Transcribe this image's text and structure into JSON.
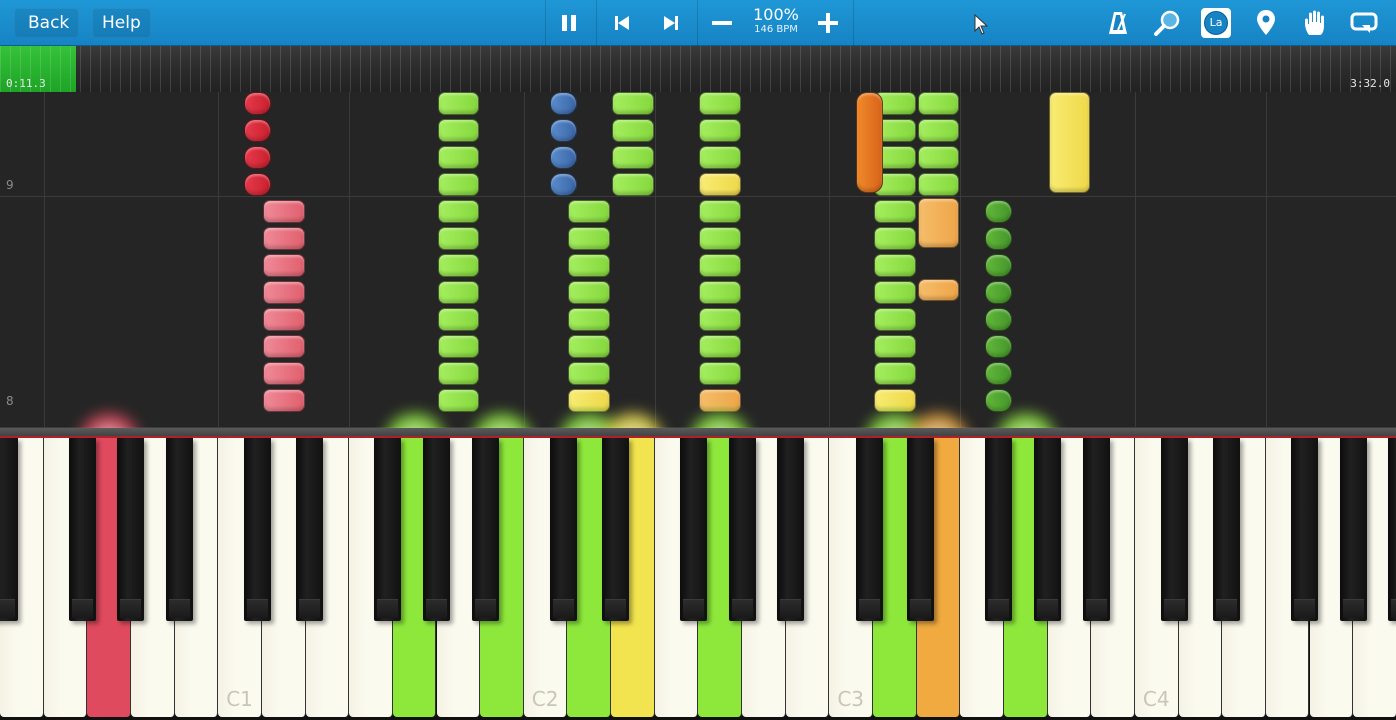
{
  "toolbar": {
    "back_label": "Back",
    "help_label": "Help",
    "tempo_percent": "100%",
    "tempo_bpm": "146 BPM",
    "icons": [
      "pause-icon",
      "skip-back-icon",
      "skip-forward-icon",
      "minus-icon",
      "plus-icon",
      "metronome-icon",
      "magnifier-icon",
      "note-label-icon",
      "location-pin-icon",
      "hand-icon",
      "loop-icon"
    ],
    "note_label_badge": "La",
    "accent_color": "#1a8dcc"
  },
  "timeline": {
    "current_time": "0:11.3",
    "total_time": "3:32.0",
    "progress_fraction": 0.053
  },
  "notes_area": {
    "measures": [
      "9",
      "8"
    ]
  },
  "keyboard": {
    "octave_labels": [
      "C1",
      "C2",
      "C3",
      "C4"
    ],
    "pressed_keys": [
      {
        "key": "G0",
        "color": "#e04a5e"
      },
      {
        "key": "G1",
        "color": "#8ee83c"
      },
      {
        "key": "B1",
        "color": "#8ee83c"
      },
      {
        "key": "D2",
        "color": "#8ee83c"
      },
      {
        "key": "E2",
        "color": "#f1e44e"
      },
      {
        "key": "G2",
        "color": "#8ee83c"
      },
      {
        "key": "D3",
        "color": "#8ee83c"
      },
      {
        "key": "E3",
        "color": "#f0aa40"
      },
      {
        "key": "G3",
        "color": "#8ee83c"
      }
    ]
  }
}
